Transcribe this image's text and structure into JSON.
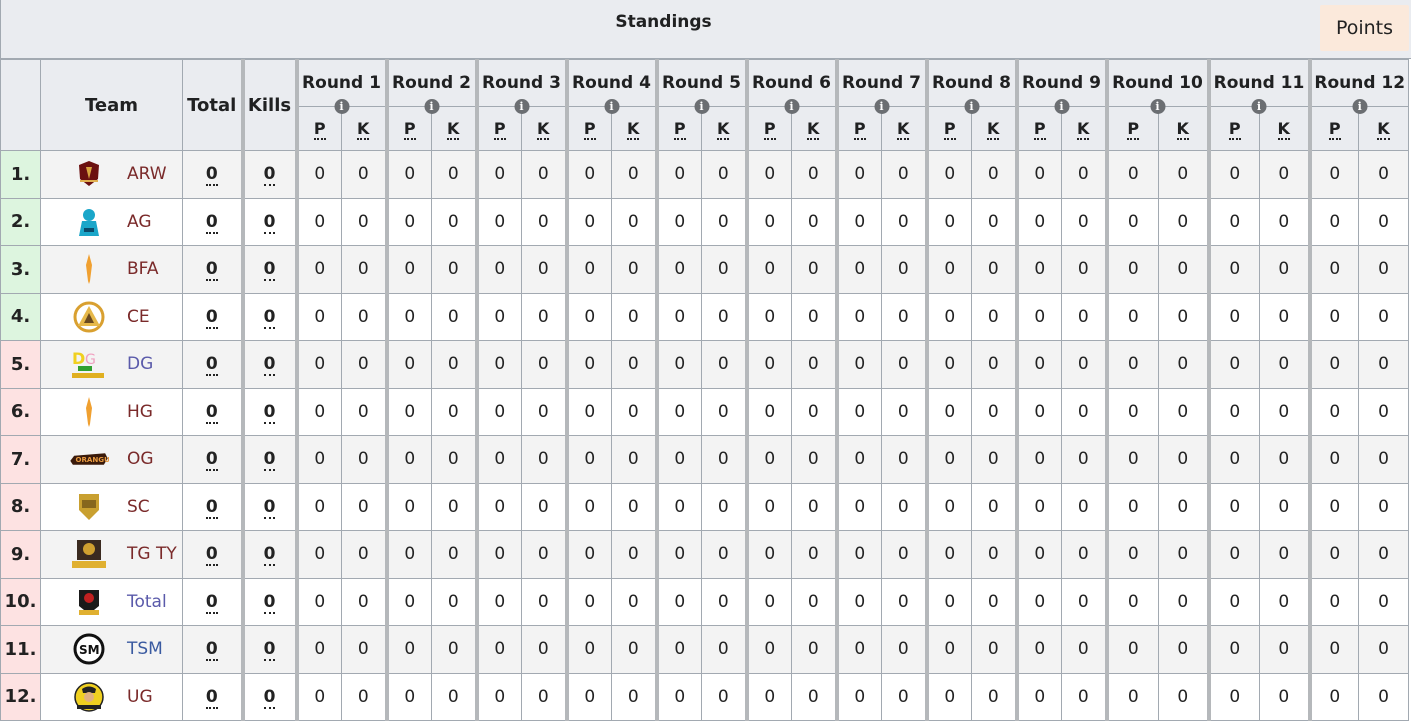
{
  "header": {
    "title": "Standings",
    "points_button": "Points"
  },
  "columns": {
    "team": "Team",
    "total": "Total",
    "kills": "Kills",
    "p_label": "P",
    "k_label": "K",
    "info_icon": "i",
    "rounds": [
      "Round 1",
      "Round 2",
      "Round 3",
      "Round 4",
      "Round 5",
      "Round 6",
      "Round 7",
      "Round 8",
      "Round 9",
      "Round 10",
      "Round 11",
      "Round 12"
    ]
  },
  "rows": [
    {
      "rank": "1.",
      "team": "ARW",
      "logo": "arw-logo",
      "total": "0",
      "kills": "0",
      "status": "qualified",
      "name_color": "dark",
      "rounds": [
        [
          "0",
          "0"
        ],
        [
          "0",
          "0"
        ],
        [
          "0",
          "0"
        ],
        [
          "0",
          "0"
        ],
        [
          "0",
          "0"
        ],
        [
          "0",
          "0"
        ],
        [
          "0",
          "0"
        ],
        [
          "0",
          "0"
        ],
        [
          "0",
          "0"
        ],
        [
          "0",
          "0"
        ],
        [
          "0",
          "0"
        ],
        [
          "0",
          "0"
        ]
      ]
    },
    {
      "rank": "2.",
      "team": "AG",
      "logo": "ag-logo",
      "total": "0",
      "kills": "0",
      "status": "qualified",
      "name_color": "dark",
      "rounds": [
        [
          "0",
          "0"
        ],
        [
          "0",
          "0"
        ],
        [
          "0",
          "0"
        ],
        [
          "0",
          "0"
        ],
        [
          "0",
          "0"
        ],
        [
          "0",
          "0"
        ],
        [
          "0",
          "0"
        ],
        [
          "0",
          "0"
        ],
        [
          "0",
          "0"
        ],
        [
          "0",
          "0"
        ],
        [
          "0",
          "0"
        ],
        [
          "0",
          "0"
        ]
      ]
    },
    {
      "rank": "3.",
      "team": "BFA",
      "logo": "bfa-logo",
      "total": "0",
      "kills": "0",
      "status": "qualified",
      "name_color": "dark",
      "rounds": [
        [
          "0",
          "0"
        ],
        [
          "0",
          "0"
        ],
        [
          "0",
          "0"
        ],
        [
          "0",
          "0"
        ],
        [
          "0",
          "0"
        ],
        [
          "0",
          "0"
        ],
        [
          "0",
          "0"
        ],
        [
          "0",
          "0"
        ],
        [
          "0",
          "0"
        ],
        [
          "0",
          "0"
        ],
        [
          "0",
          "0"
        ],
        [
          "0",
          "0"
        ]
      ]
    },
    {
      "rank": "4.",
      "team": "CE",
      "logo": "ce-logo",
      "total": "0",
      "kills": "0",
      "status": "qualified",
      "name_color": "dark",
      "rounds": [
        [
          "0",
          "0"
        ],
        [
          "0",
          "0"
        ],
        [
          "0",
          "0"
        ],
        [
          "0",
          "0"
        ],
        [
          "0",
          "0"
        ],
        [
          "0",
          "0"
        ],
        [
          "0",
          "0"
        ],
        [
          "0",
          "0"
        ],
        [
          "0",
          "0"
        ],
        [
          "0",
          "0"
        ],
        [
          "0",
          "0"
        ],
        [
          "0",
          "0"
        ]
      ]
    },
    {
      "rank": "5.",
      "team": "DG",
      "logo": "dg-logo",
      "total": "0",
      "kills": "0",
      "status": "eliminated",
      "name_color": "blue",
      "rounds": [
        [
          "0",
          "0"
        ],
        [
          "0",
          "0"
        ],
        [
          "0",
          "0"
        ],
        [
          "0",
          "0"
        ],
        [
          "0",
          "0"
        ],
        [
          "0",
          "0"
        ],
        [
          "0",
          "0"
        ],
        [
          "0",
          "0"
        ],
        [
          "0",
          "0"
        ],
        [
          "0",
          "0"
        ],
        [
          "0",
          "0"
        ],
        [
          "0",
          "0"
        ]
      ]
    },
    {
      "rank": "6.",
      "team": "HG",
      "logo": "hg-logo",
      "total": "0",
      "kills": "0",
      "status": "eliminated",
      "name_color": "dark",
      "rounds": [
        [
          "0",
          "0"
        ],
        [
          "0",
          "0"
        ],
        [
          "0",
          "0"
        ],
        [
          "0",
          "0"
        ],
        [
          "0",
          "0"
        ],
        [
          "0",
          "0"
        ],
        [
          "0",
          "0"
        ],
        [
          "0",
          "0"
        ],
        [
          "0",
          "0"
        ],
        [
          "0",
          "0"
        ],
        [
          "0",
          "0"
        ],
        [
          "0",
          "0"
        ]
      ]
    },
    {
      "rank": "7.",
      "team": "OG",
      "logo": "og-logo",
      "total": "0",
      "kills": "0",
      "status": "eliminated",
      "name_color": "dark",
      "rounds": [
        [
          "0",
          "0"
        ],
        [
          "0",
          "0"
        ],
        [
          "0",
          "0"
        ],
        [
          "0",
          "0"
        ],
        [
          "0",
          "0"
        ],
        [
          "0",
          "0"
        ],
        [
          "0",
          "0"
        ],
        [
          "0",
          "0"
        ],
        [
          "0",
          "0"
        ],
        [
          "0",
          "0"
        ],
        [
          "0",
          "0"
        ],
        [
          "0",
          "0"
        ]
      ]
    },
    {
      "rank": "8.",
      "team": "SC",
      "logo": "sc-logo",
      "total": "0",
      "kills": "0",
      "status": "eliminated",
      "name_color": "dark",
      "rounds": [
        [
          "0",
          "0"
        ],
        [
          "0",
          "0"
        ],
        [
          "0",
          "0"
        ],
        [
          "0",
          "0"
        ],
        [
          "0",
          "0"
        ],
        [
          "0",
          "0"
        ],
        [
          "0",
          "0"
        ],
        [
          "0",
          "0"
        ],
        [
          "0",
          "0"
        ],
        [
          "0",
          "0"
        ],
        [
          "0",
          "0"
        ],
        [
          "0",
          "0"
        ]
      ]
    },
    {
      "rank": "9.",
      "team": "TG TY",
      "logo": "tg-ty-logo",
      "total": "0",
      "kills": "0",
      "status": "eliminated",
      "name_color": "dark",
      "rounds": [
        [
          "0",
          "0"
        ],
        [
          "0",
          "0"
        ],
        [
          "0",
          "0"
        ],
        [
          "0",
          "0"
        ],
        [
          "0",
          "0"
        ],
        [
          "0",
          "0"
        ],
        [
          "0",
          "0"
        ],
        [
          "0",
          "0"
        ],
        [
          "0",
          "0"
        ],
        [
          "0",
          "0"
        ],
        [
          "0",
          "0"
        ],
        [
          "0",
          "0"
        ]
      ]
    },
    {
      "rank": "10.",
      "team": "Total",
      "logo": "total-gaming-logo",
      "total": "0",
      "kills": "0",
      "status": "eliminated",
      "name_color": "blue",
      "rounds": [
        [
          "0",
          "0"
        ],
        [
          "0",
          "0"
        ],
        [
          "0",
          "0"
        ],
        [
          "0",
          "0"
        ],
        [
          "0",
          "0"
        ],
        [
          "0",
          "0"
        ],
        [
          "0",
          "0"
        ],
        [
          "0",
          "0"
        ],
        [
          "0",
          "0"
        ],
        [
          "0",
          "0"
        ],
        [
          "0",
          "0"
        ],
        [
          "0",
          "0"
        ]
      ]
    },
    {
      "rank": "11.",
      "team": "TSM",
      "logo": "tsm-logo",
      "total": "0",
      "kills": "0",
      "status": "eliminated",
      "name_color": "navy",
      "rounds": [
        [
          "0",
          "0"
        ],
        [
          "0",
          "0"
        ],
        [
          "0",
          "0"
        ],
        [
          "0",
          "0"
        ],
        [
          "0",
          "0"
        ],
        [
          "0",
          "0"
        ],
        [
          "0",
          "0"
        ],
        [
          "0",
          "0"
        ],
        [
          "0",
          "0"
        ],
        [
          "0",
          "0"
        ],
        [
          "0",
          "0"
        ],
        [
          "0",
          "0"
        ]
      ]
    },
    {
      "rank": "12.",
      "team": "UG",
      "logo": "ug-logo",
      "total": "0",
      "kills": "0",
      "status": "eliminated",
      "name_color": "dark",
      "rounds": [
        [
          "0",
          "0"
        ],
        [
          "0",
          "0"
        ],
        [
          "0",
          "0"
        ],
        [
          "0",
          "0"
        ],
        [
          "0",
          "0"
        ],
        [
          "0",
          "0"
        ],
        [
          "0",
          "0"
        ],
        [
          "0",
          "0"
        ],
        [
          "0",
          "0"
        ],
        [
          "0",
          "0"
        ],
        [
          "0",
          "0"
        ],
        [
          "0",
          "0"
        ]
      ]
    }
  ],
  "colors": {
    "qualified_bg": "#ddf5df",
    "eliminated_bg": "#fde2e2",
    "header_bg": "#eaecf0",
    "points_bg": "#fbe9db"
  }
}
